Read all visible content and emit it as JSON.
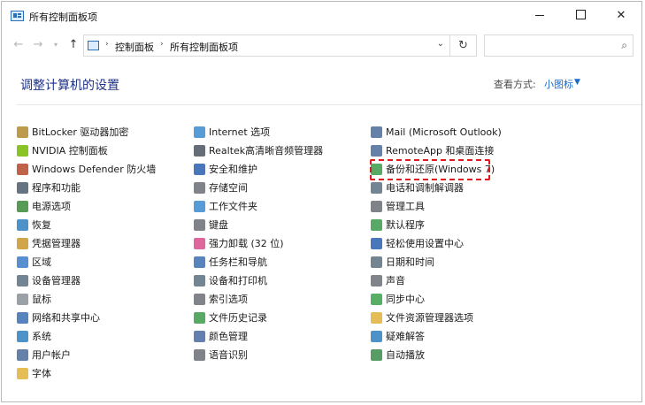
{
  "window": {
    "title": "所有控制面板项",
    "controls": {
      "minimize": "",
      "maximize": "",
      "close": "✕"
    }
  },
  "navigation": {
    "back": "←",
    "forward": "→",
    "recent": "▾",
    "up": "↑",
    "breadcrumb": [
      "控制面板",
      "所有控制面板项"
    ],
    "separator": "›",
    "dropdown": "⌄",
    "refresh": "↻",
    "search_placeholder": "",
    "search_icon": "⌕"
  },
  "header": {
    "title": "调整计算机的设置",
    "view_by_label": "查看方式:",
    "view_by_value": "小图标",
    "view_by_caret": "▼"
  },
  "columns": [
    [
      {
        "label": "BitLocker 驱动器加密",
        "icon": "bitlocker-icon",
        "color": "#b08a2e"
      },
      {
        "label": "NVIDIA 控制面板",
        "icon": "nvidia-icon",
        "color": "#76b900"
      },
      {
        "label": "Windows Defender 防火墙",
        "icon": "firewall-icon",
        "color": "#b5452a"
      },
      {
        "label": "程序和功能",
        "icon": "programs-icon",
        "color": "#4b5a6a"
      },
      {
        "label": "电源选项",
        "icon": "power-icon",
        "color": "#3a8a3a"
      },
      {
        "label": "恢复",
        "icon": "recovery-icon",
        "color": "#2f7fc1"
      },
      {
        "label": "凭据管理器",
        "icon": "credential-icon",
        "color": "#c9962c"
      },
      {
        "label": "区域",
        "icon": "region-icon",
        "color": "#3a7bc8"
      },
      {
        "label": "设备管理器",
        "icon": "device-manager-icon",
        "color": "#5b6e7f"
      },
      {
        "label": "鼠标",
        "icon": "mouse-icon",
        "color": "#8a8f96"
      },
      {
        "label": "网络和共享中心",
        "icon": "network-icon",
        "color": "#3a6fb0"
      },
      {
        "label": "系统",
        "icon": "system-icon",
        "color": "#2f7fc1"
      },
      {
        "label": "用户帐户",
        "icon": "user-accounts-icon",
        "color": "#4a6a9a"
      },
      {
        "label": "字体",
        "icon": "fonts-icon",
        "color": "#e0b23a"
      }
    ],
    [
      {
        "label": "Internet 选项",
        "icon": "internet-options-icon",
        "color": "#3a8ad0"
      },
      {
        "label": "Realtek高清晰音频管理器",
        "icon": "realtek-audio-icon",
        "color": "#4a5560"
      },
      {
        "label": "安全和维护",
        "icon": "flag-icon",
        "color": "#2a5fb0"
      },
      {
        "label": "存储空间",
        "icon": "storage-icon",
        "color": "#6a6f76"
      },
      {
        "label": "工作文件夹",
        "icon": "work-folders-icon",
        "color": "#3a8ad0"
      },
      {
        "label": "键盘",
        "icon": "keyboard-icon",
        "color": "#6a6f76"
      },
      {
        "label": "强力卸载 (32 位)",
        "icon": "uninstall-icon",
        "color": "#d94a8c"
      },
      {
        "label": "任务栏和导航",
        "icon": "taskbar-icon",
        "color": "#3a6fb0"
      },
      {
        "label": "设备和打印机",
        "icon": "printer-icon",
        "color": "#5b6e7f"
      },
      {
        "label": "索引选项",
        "icon": "index-icon",
        "color": "#6a6f76"
      },
      {
        "label": "文件历史记录",
        "icon": "file-history-icon",
        "color": "#3a9a4a"
      },
      {
        "label": "颜色管理",
        "icon": "color-management-icon",
        "color": "#4a6aa0"
      },
      {
        "label": "语音识别",
        "icon": "microphone-icon",
        "color": "#6a6f76"
      }
    ],
    [
      {
        "label": "Mail (Microsoft Outlook)",
        "icon": "mail-icon",
        "color": "#4a6a9a"
      },
      {
        "label": "RemoteApp 和桌面连接",
        "icon": "remoteapp-icon",
        "color": "#4a6a9a"
      },
      {
        "label": "备份和还原(Windows 7)",
        "icon": "backup-restore-icon",
        "color": "#3a9a4a"
      },
      {
        "label": "电话和调制解调器",
        "icon": "phone-modem-icon",
        "color": "#5b6e7f"
      },
      {
        "label": "管理工具",
        "icon": "admin-tools-icon",
        "color": "#6a6f76"
      },
      {
        "label": "默认程序",
        "icon": "default-programs-icon",
        "color": "#3a9a4a"
      },
      {
        "label": "轻松使用设置中心",
        "icon": "ease-of-access-icon",
        "color": "#2a5fb0"
      },
      {
        "label": "日期和时间",
        "icon": "clock-icon",
        "color": "#5b6e7f"
      },
      {
        "label": "声音",
        "icon": "speaker-icon",
        "color": "#6a6f76"
      },
      {
        "label": "同步中心",
        "icon": "sync-icon",
        "color": "#3aa04a"
      },
      {
        "label": "文件资源管理器选项",
        "icon": "folder-options-icon",
        "color": "#e0b23a"
      },
      {
        "label": "疑难解答",
        "icon": "troubleshooting-icon",
        "color": "#2f7fc1"
      },
      {
        "label": "自动播放",
        "icon": "autoplay-icon",
        "color": "#3a8a4a"
      }
    ]
  ],
  "highlight": {
    "item": "备份和还原(Windows 7)",
    "color": "#e0191e"
  }
}
